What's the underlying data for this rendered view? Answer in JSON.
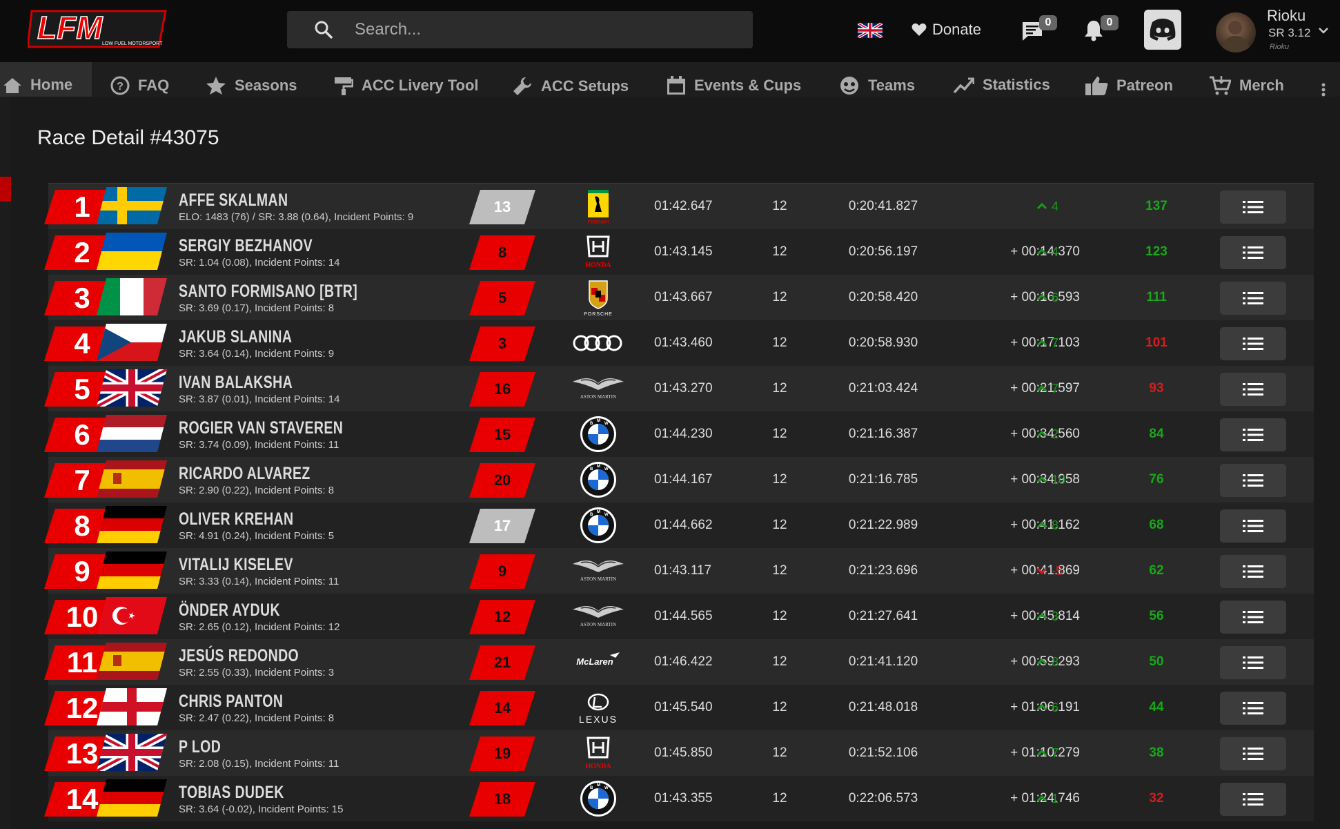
{
  "header": {
    "logo_text": "LFM",
    "logo_subtext": "LOW FUEL MOTORSPORT",
    "search_placeholder": "Search...",
    "donate_label": "Donate",
    "messages_count": "0",
    "notifications_count": "0",
    "user_name": "Rioku",
    "user_sr": "SR 3.12",
    "user_signature": "Rioku"
  },
  "nav": [
    {
      "label": "Home",
      "icon": "home-icon"
    },
    {
      "label": "FAQ",
      "icon": "question-circle-icon"
    },
    {
      "label": "Seasons",
      "icon": "star-icon"
    },
    {
      "label": "ACC Livery Tool",
      "icon": "paint-roller-icon"
    },
    {
      "label": "ACC Setups",
      "icon": "wrench-icon"
    },
    {
      "label": "Events & Cups",
      "icon": "calendar-icon"
    },
    {
      "label": "Teams",
      "icon": "group-icon"
    },
    {
      "label": "Statistics",
      "icon": "chart-line-icon"
    },
    {
      "label": "Patreon",
      "icon": "thumbs-up-icon"
    },
    {
      "label": "Merch",
      "icon": "cart-icon"
    }
  ],
  "page_title": "Race Detail #43075",
  "colors": {
    "accent_red": "#e80000",
    "gray_plate": "#bdbdbd",
    "points_green": "#18a818",
    "points_red": "#d61c1c"
  },
  "rows": [
    {
      "pos": "1",
      "flag": "sweden",
      "name": "AFFE SKALMAN",
      "info": "ELO: 1483 (76) / SR: 3.88 (0.64), Incident Points: 9",
      "number": "13",
      "plate": "gray",
      "car": "ferrari",
      "best": "01:42.647",
      "laps": "12",
      "total": "0:20:41.827",
      "gap": "",
      "dir": "up",
      "change": "4",
      "points": "137",
      "pts_color": "green"
    },
    {
      "pos": "2",
      "flag": "ukraine",
      "name": "SERGIY BEZHANOV",
      "info": "SR: 1.04 (0.08), Incident Points: 14",
      "number": "8",
      "plate": "red",
      "car": "honda",
      "best": "01:43.145",
      "laps": "12",
      "total": "0:20:56.197",
      "gap": "+ 00:14.370",
      "dir": "up",
      "change": "4",
      "points": "123",
      "pts_color": "green"
    },
    {
      "pos": "3",
      "flag": "italy",
      "name": "SANTO FORMISANO [BTR]",
      "info": "SR: 3.69 (0.17), Incident Points: 8",
      "number": "5",
      "plate": "red",
      "car": "porsche",
      "best": "01:43.667",
      "laps": "12",
      "total": "0:20:58.420",
      "gap": "+ 00:16.593",
      "dir": "up",
      "change": "6",
      "points": "111",
      "pts_color": "green"
    },
    {
      "pos": "4",
      "flag": "czech",
      "name": "JAKUB SLANINA",
      "info": "SR: 3.64 (0.14), Incident Points: 9",
      "number": "3",
      "plate": "red",
      "car": "audi",
      "best": "01:43.460",
      "laps": "12",
      "total": "0:20:58.930",
      "gap": "+ 00:17.103",
      "dir": "up",
      "change": "7",
      "points": "101",
      "pts_color": "red"
    },
    {
      "pos": "5",
      "flag": "uk",
      "name": "IVAN BALAKSHA",
      "info": "SR: 3.87 (0.01), Incident Points: 14",
      "number": "16",
      "plate": "red",
      "car": "aston",
      "best": "01:43.270",
      "laps": "12",
      "total": "0:21:03.424",
      "gap": "+ 00:21.597",
      "dir": "up",
      "change": "7",
      "points": "93",
      "pts_color": "red"
    },
    {
      "pos": "6",
      "flag": "netherlands",
      "name": "ROGIER VAN STAVEREN",
      "info": "SR: 3.74 (0.09), Incident Points: 11",
      "number": "15",
      "plate": "red",
      "car": "bmw",
      "best": "01:44.230",
      "laps": "12",
      "total": "0:21:16.387",
      "gap": "+ 00:34.560",
      "dir": "up",
      "change": "2",
      "points": "84",
      "pts_color": "green"
    },
    {
      "pos": "7",
      "flag": "spain",
      "name": "RICARDO ALVAREZ",
      "info": "SR: 2.90 (0.22), Incident Points: 8",
      "number": "20",
      "plate": "red",
      "car": "bmw",
      "best": "01:44.167",
      "laps": "12",
      "total": "0:21:16.785",
      "gap": "+ 00:34.958",
      "dir": "up",
      "change": "10",
      "points": "76",
      "pts_color": "green"
    },
    {
      "pos": "8",
      "flag": "germany",
      "name": "OLIVER KREHAN",
      "info": "SR: 4.91 (0.24), Incident Points: 5",
      "number": "17",
      "plate": "gray",
      "car": "bmw",
      "best": "01:44.662",
      "laps": "12",
      "total": "0:21:22.989",
      "gap": "+ 00:41.162",
      "dir": "up",
      "change": "8",
      "points": "68",
      "pts_color": "green"
    },
    {
      "pos": "9",
      "flag": "germany",
      "name": "VITALIJ KISELEV",
      "info": "SR: 3.33 (0.14), Incident Points: 11",
      "number": "9",
      "plate": "red",
      "car": "aston",
      "best": "01:43.117",
      "laps": "12",
      "total": "0:21:23.696",
      "gap": "+ 00:41.869",
      "dir": "down",
      "change": "-5",
      "points": "62",
      "pts_color": "green"
    },
    {
      "pos": "10",
      "flag": "turkey",
      "name": "ÖNDER AYDUK",
      "info": "SR: 2.65 (0.12), Incident Points: 12",
      "number": "12",
      "plate": "red",
      "car": "aston",
      "best": "01:44.565",
      "laps": "12",
      "total": "0:21:27.641",
      "gap": "+ 00:45.814",
      "dir": "up",
      "change": "3",
      "points": "56",
      "pts_color": "green"
    },
    {
      "pos": "11",
      "flag": "spain",
      "name": "JESÚS REDONDO",
      "info": "SR: 2.55 (0.33), Incident Points: 3",
      "number": "21",
      "plate": "red",
      "car": "mclaren",
      "best": "01:46.422",
      "laps": "12",
      "total": "0:21:41.120",
      "gap": "+ 00:59.293",
      "dir": "up",
      "change": "8",
      "points": "50",
      "pts_color": "green"
    },
    {
      "pos": "12",
      "flag": "england",
      "name": "CHRIS PANTON",
      "info": "SR: 2.47 (0.22), Incident Points: 8",
      "number": "14",
      "plate": "red",
      "car": "lexus",
      "best": "01:45.540",
      "laps": "12",
      "total": "0:21:48.018",
      "gap": "+ 01:06.191",
      "dir": "up",
      "change": "6",
      "points": "44",
      "pts_color": "green"
    },
    {
      "pos": "13",
      "flag": "uk",
      "name": "P LOD",
      "info": "SR: 2.08 (0.15), Incident Points: 11",
      "number": "19",
      "plate": "red",
      "car": "honda",
      "best": "01:45.850",
      "laps": "12",
      "total": "0:21:52.106",
      "gap": "+ 01:10.279",
      "dir": "up",
      "change": "7",
      "points": "38",
      "pts_color": "green"
    },
    {
      "pos": "14",
      "flag": "germany",
      "name": "TOBIAS DUDEK",
      "info": "SR: 3.64 (-0.02), Incident Points: 15",
      "number": "18",
      "plate": "red",
      "car": "bmw",
      "best": "01:43.355",
      "laps": "12",
      "total": "0:22:06.573",
      "gap": "+ 01:24.746",
      "dir": "up",
      "change": "1",
      "points": "32",
      "pts_color": "red"
    }
  ]
}
